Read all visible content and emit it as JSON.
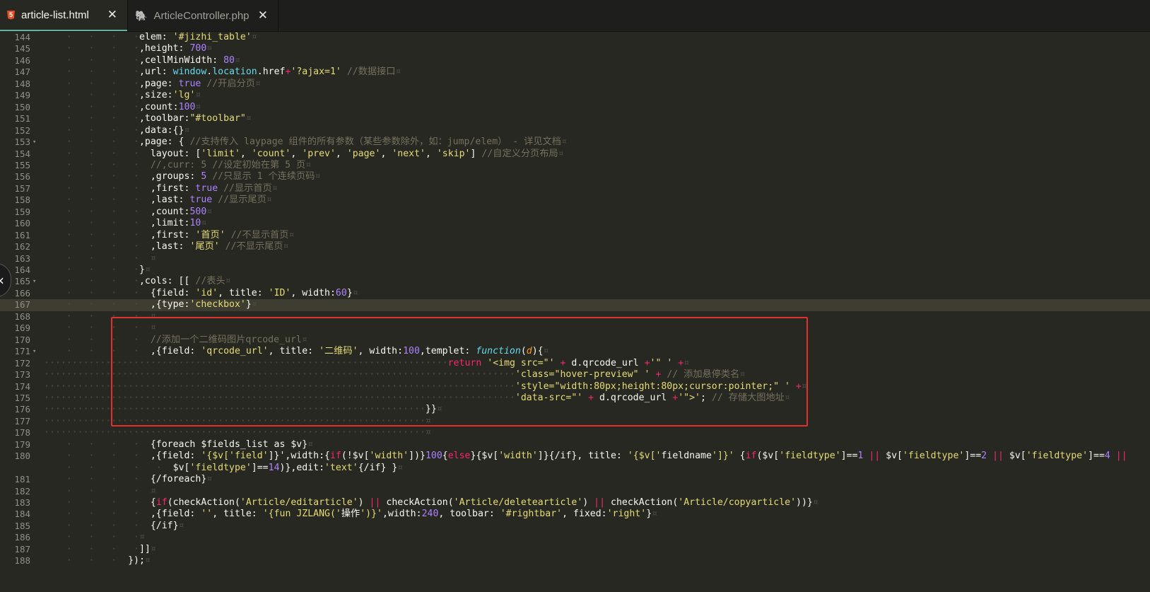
{
  "tabs": [
    {
      "label": "article-list.html",
      "icon": "html5-icon",
      "active": true
    },
    {
      "label": "ArticleController.php",
      "icon": "php-elephant-icon",
      "active": false
    }
  ],
  "tab_close_glyph": "✕",
  "sidebar_toggle_glyph": "‹",
  "editor": {
    "lines": [
      {
        "n": "144",
        "ind": 17,
        "fold": "",
        "html": "elem: <span class='s'>'#jizhi_table'</span><span class='ws'>¤</span>"
      },
      {
        "n": "145",
        "ind": 17,
        "fold": "",
        "html": ",height: <span class='n'>700</span><span class='ws'>¤</span>"
      },
      {
        "n": "146",
        "ind": 17,
        "fold": "",
        "html": ",cellMinWidth: <span class='n'>80</span><span class='ws'>¤</span>"
      },
      {
        "n": "147",
        "ind": 17,
        "fold": "",
        "html": ",url: <span class='b'>window</span>.<span class='b'>location</span>.href<span class='k'>+</span><span class='s'>'?ajax=1'</span> <span class='c'>//数据接口</span><span class='ws'>¤</span>"
      },
      {
        "n": "148",
        "ind": 17,
        "fold": "",
        "html": ",page: <span class='n'>true</span> <span class='c'>//开启分页</span><span class='ws'>¤</span>"
      },
      {
        "n": "149",
        "ind": 17,
        "fold": "",
        "html": ",size:<span class='s'>'lg'</span><span class='ws'>¤</span>"
      },
      {
        "n": "150",
        "ind": 17,
        "fold": "",
        "html": ",count:<span class='n'>100</span><span class='ws'>¤</span>"
      },
      {
        "n": "151",
        "ind": 17,
        "fold": "",
        "html": ",toolbar:<span class='s'>\"#toolbar\"</span><span class='ws'>¤</span>"
      },
      {
        "n": "152",
        "ind": 17,
        "fold": "",
        "html": ",data:{}<span class='ws'>¤</span>"
      },
      {
        "n": "153",
        "ind": 17,
        "fold": "▾",
        "html": ",page: { <span class='c'>//支持传入 laypage 组件的所有参数（某些参数除外，如：jump/elem） - 详见文档</span><span class='ws'>¤</span>"
      },
      {
        "n": "154",
        "ind": 19,
        "fold": "",
        "html": "layout: [<span class='s'>'limit'</span>, <span class='s'>'count'</span>, <span class='s'>'prev'</span>, <span class='s'>'page'</span>, <span class='s'>'next'</span>, <span class='s'>'skip'</span>] <span class='c'>//自定义分页布局</span><span class='ws'>¤</span>"
      },
      {
        "n": "155",
        "ind": 19,
        "fold": "",
        "html": "<span class='c'>//,curr: 5 //设定初始在第 5 页</span><span class='ws'>¤</span>"
      },
      {
        "n": "156",
        "ind": 19,
        "fold": "",
        "html": ",groups: <span class='n'>5</span> <span class='c'>//只显示 1 个连续页码</span><span class='ws'>¤</span>"
      },
      {
        "n": "157",
        "ind": 19,
        "fold": "",
        "html": ",first: <span class='n'>true</span> <span class='c'>//显示首页</span><span class='ws'>¤</span>"
      },
      {
        "n": "158",
        "ind": 19,
        "fold": "",
        "html": ",last: <span class='n'>true</span> <span class='c'>//显示尾页</span><span class='ws'>¤</span>"
      },
      {
        "n": "159",
        "ind": 19,
        "fold": "",
        "html": ",count:<span class='n'>500</span><span class='ws'>¤</span>"
      },
      {
        "n": "160",
        "ind": 19,
        "fold": "",
        "html": ",limit:<span class='n'>10</span><span class='ws'>¤</span>"
      },
      {
        "n": "161",
        "ind": 19,
        "fold": "",
        "html": ",first: <span class='s'>'首页'</span> <span class='c'>//不显示首页</span><span class='ws'>¤</span>"
      },
      {
        "n": "162",
        "ind": 19,
        "fold": "",
        "html": ",last: <span class='s'>'尾页'</span> <span class='c'>//不显示尾页</span><span class='ws'>¤</span>"
      },
      {
        "n": "163",
        "ind": 19,
        "fold": "",
        "html": "<span class='ws'>¤</span>"
      },
      {
        "n": "164",
        "ind": 17,
        "fold": "",
        "html": "}<span class='ws'>¤</span>"
      },
      {
        "n": "165",
        "ind": 17,
        "fold": "▾",
        "html": ",cols: [[ <span class='c'>//表头</span><span class='ws'>¤</span>"
      },
      {
        "n": "166",
        "ind": 19,
        "fold": "",
        "html": "{field: <span class='s'>'id'</span>, title: <span class='s'>'ID'</span>, width:<span class='n'>60</span>}<span class='ws'>¤</span>"
      },
      {
        "n": "167",
        "ind": 19,
        "fold": "",
        "html": ",{type:<span class='s'>'checkbox'</span>}<span class='ws'>¤</span>",
        "hl": true
      },
      {
        "n": "168",
        "ind": 19,
        "fold": "",
        "html": "<span class='ws'>¤</span>"
      },
      {
        "n": "169",
        "ind": 19,
        "fold": "",
        "html": "<span class='ws'>¤</span>"
      },
      {
        "n": "170",
        "ind": 19,
        "fold": "",
        "html": "<span class='c'>//添加一个二维码图片qrcode_url</span><span class='ws'>¤</span>"
      },
      {
        "n": "171",
        "ind": 19,
        "fold": "▾",
        "html": ",{field: <span class='s'>'qrcode_url'</span>, title: <span class='s'>'二维码'</span>, width:<span class='n'>100</span>,templet: <span class='f'>function</span>(<span class='p'>d</span>){<span class='ws'>¤</span>"
      },
      {
        "n": "172",
        "ind": 72,
        "fold": "",
        "dots": true,
        "html": "<span class='k'>return</span> <span class='s'>'&lt;img src=\"'</span> <span class='k'>+</span> d.qrcode_url <span class='k'>+</span><span class='s'>'\" '</span> <span class='k'>+</span><span class='ws'>¤</span>"
      },
      {
        "n": "173",
        "ind": 84,
        "fold": "",
        "dots": true,
        "html": "<span class='s'>'class=\"hover-preview\" '</span> <span class='k'>+</span> <span class='c'>// 添加悬停类名</span><span class='ws'>¤</span>"
      },
      {
        "n": "174",
        "ind": 84,
        "fold": "",
        "dots": true,
        "html": "<span class='s'>'style=\"width:80px;height:80px;cursor:pointer;\" '</span> <span class='k'>+</span><span class='ws'>¤</span>"
      },
      {
        "n": "175",
        "ind": 84,
        "fold": "",
        "dots": true,
        "html": "<span class='s'>'data-src=\"'</span> <span class='k'>+</span> d.qrcode_url <span class='k'>+</span><span class='s'>'\"&gt;'</span>; <span class='c'>// 存储大图地址</span><span class='ws'>¤</span>"
      },
      {
        "n": "176",
        "ind": 68,
        "fold": "",
        "dots": true,
        "html": "}}<span class='ws'>¤</span>"
      },
      {
        "n": "177",
        "ind": 68,
        "fold": "",
        "dots": true,
        "html": "<span class='ws'>¤</span>"
      },
      {
        "n": "178",
        "ind": 68,
        "fold": "",
        "dots": true,
        "html": "<span class='ws'>¤</span>"
      },
      {
        "n": "179",
        "ind": 19,
        "fold": "",
        "html": "{foreach $fields_list as $v}<span class='ws'>¤</span>"
      },
      {
        "n": "180",
        "ind": 19,
        "fold": "",
        "html": ",{field: <span class='s'>'{$v['</span><span class='s'>field'</span>]}',width:{<span class='k'>if</span>(!$v[<span class='s'>'width'</span>])}<span class='n'>100</span>{<span class='k'>else</span>}{$v[<span class='s'>'width'</span>]}{/if}, title: <span class='s'>'{$v['</span>fieldname<span class='s'>']}'</span> {<span class='k'>if</span>($v[<span class='s'>'fieldtype'</span>]==<span class='n'>1</span> <span class='k'>||</span> $v[<span class='s'>'fieldtype'</span>]==<span class='n'>2</span> <span class='k'>||</span> $v[<span class='s'>'fieldtype'</span>]==<span class='n'>4</span> <span class='k'>||</span>"
      },
      {
        "n": "",
        "ind": 23,
        "fold": "",
        "html": "$v[<span class='s'>'fieldtype'</span>]==<span class='n'>14</span>)},edit:<span class='s'>'text'</span>{/if} }<span class='ws'>¤</span>"
      },
      {
        "n": "181",
        "ind": 19,
        "fold": "",
        "html": "{/foreach}<span class='ws'>¤</span>"
      },
      {
        "n": "182",
        "ind": 19,
        "fold": "",
        "html": "<span class='ws'>¤</span>"
      },
      {
        "n": "183",
        "ind": 19,
        "fold": "",
        "html": "{<span class='k'>if</span>(checkAction(<span class='s'>'Article/editarticle'</span>) <span class='k'>||</span> checkAction(<span class='s'>'Article/deletearticle'</span>) <span class='k'>||</span> checkAction(<span class='s'>'Article/copyarticle'</span>))}<span class='ws'>¤</span>"
      },
      {
        "n": "184",
        "ind": 19,
        "fold": "",
        "html": ",{field: <span class='s'>''</span>, title: <span class='s'>'{fun JZLANG('</span>操作<span class='s'>')}'</span>,width:<span class='n'>240</span>, toolbar: <span class='s'>'#rightbar'</span>, fixed:<span class='s'>'right'</span>}<span class='ws'>¤</span>"
      },
      {
        "n": "185",
        "ind": 19,
        "fold": "",
        "html": "{/if}<span class='ws'>¤</span>"
      },
      {
        "n": "186",
        "ind": 17,
        "fold": "",
        "html": "<span class='ws'>¤</span>"
      },
      {
        "n": "187",
        "ind": 17,
        "fold": "",
        "html": "]]<span class='ws'>¤</span>"
      },
      {
        "n": "188",
        "ind": 15,
        "fold": "",
        "html": "});<span class='ws'>¤</span>"
      }
    ]
  }
}
